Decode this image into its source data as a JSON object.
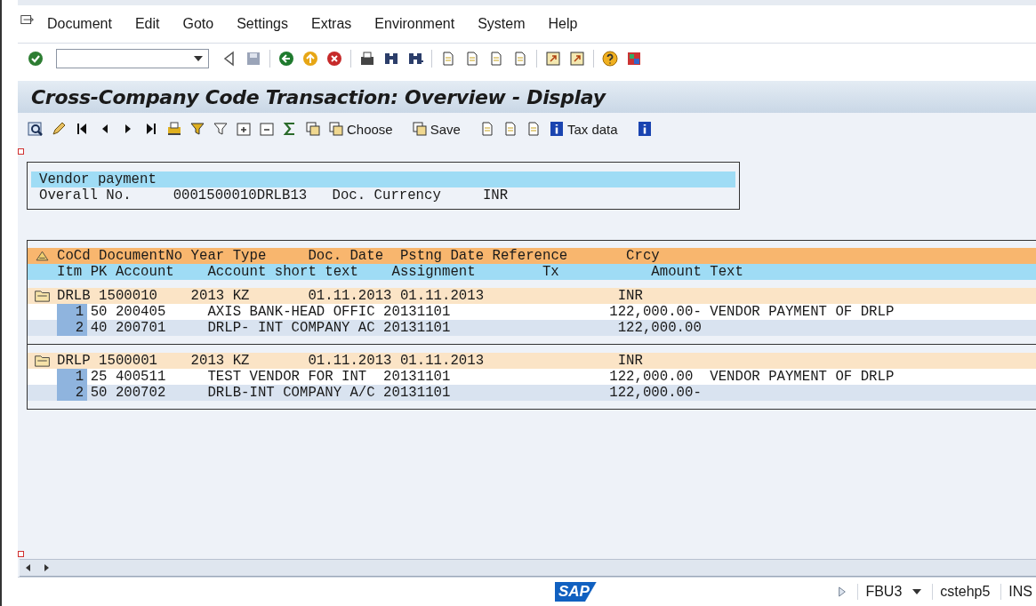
{
  "menu_bar": {
    "items": [
      "Document",
      "Edit",
      "Goto",
      "Settings",
      "Extras",
      "Environment",
      "System",
      "Help"
    ]
  },
  "title": "Cross-Company Code Transaction: Overview - Display",
  "app_toolbar": {
    "buttons": [
      "Choose",
      "Save",
      "Tax data"
    ]
  },
  "header_box": {
    "title": "Vendor payment",
    "fields": [
      {
        "label": "Overall No.",
        "value": "0001500010DRLB13"
      },
      {
        "label": "Doc. Currency",
        "value": "INR"
      }
    ]
  },
  "list": {
    "header_1": [
      "CoCd",
      "DocumentNo",
      "Year",
      "Type",
      "Doc. Date",
      "Pstng Date",
      "Reference",
      "Crcy"
    ],
    "header_2": [
      "Itm",
      "PK",
      "Account",
      "Account short text",
      "Assignment",
      "Tx",
      "Amount",
      "Text"
    ],
    "documents": [
      {
        "cocd": "DRLB",
        "doc_no": "1500010",
        "year": "2013",
        "type": "KZ",
        "doc_date": "01.11.2013",
        "posting_date": "01.11.2013",
        "currency": "INR",
        "items": [
          {
            "itm": "1",
            "pk": "50",
            "account": "200405",
            "short_text": "AXIS BANK-HEAD OFFIC",
            "assignment": "20131101",
            "amount": "122,000.00-",
            "text": "VENDOR PAYMENT OF DRLP"
          },
          {
            "itm": "2",
            "pk": "40",
            "account": "200701",
            "short_text": "DRLP- INT COMPANY AC",
            "assignment": "20131101",
            "amount": "122,000.00"
          }
        ]
      },
      {
        "cocd": "DRLP",
        "doc_no": "1500001",
        "year": "2013",
        "type": "KZ",
        "doc_date": "01.11.2013",
        "posting_date": "01.11.2013",
        "currency": "INR",
        "items": [
          {
            "itm": "1",
            "pk": "25",
            "account": "400511",
            "short_text": "TEST VENDOR FOR INT",
            "assignment": "20131101",
            "amount": "122,000.00 ",
            "text": "VENDOR PAYMENT OF DRLP"
          },
          {
            "itm": "2",
            "pk": "50",
            "account": "200702",
            "short_text": "DRLB-INT COMPANY A/C",
            "assignment": "20131101",
            "amount": "122,000.00-"
          }
        ]
      }
    ]
  },
  "status_bar": {
    "logo": "SAP",
    "transaction": "FBU3",
    "system": "cstehp5",
    "mode": "INS"
  }
}
